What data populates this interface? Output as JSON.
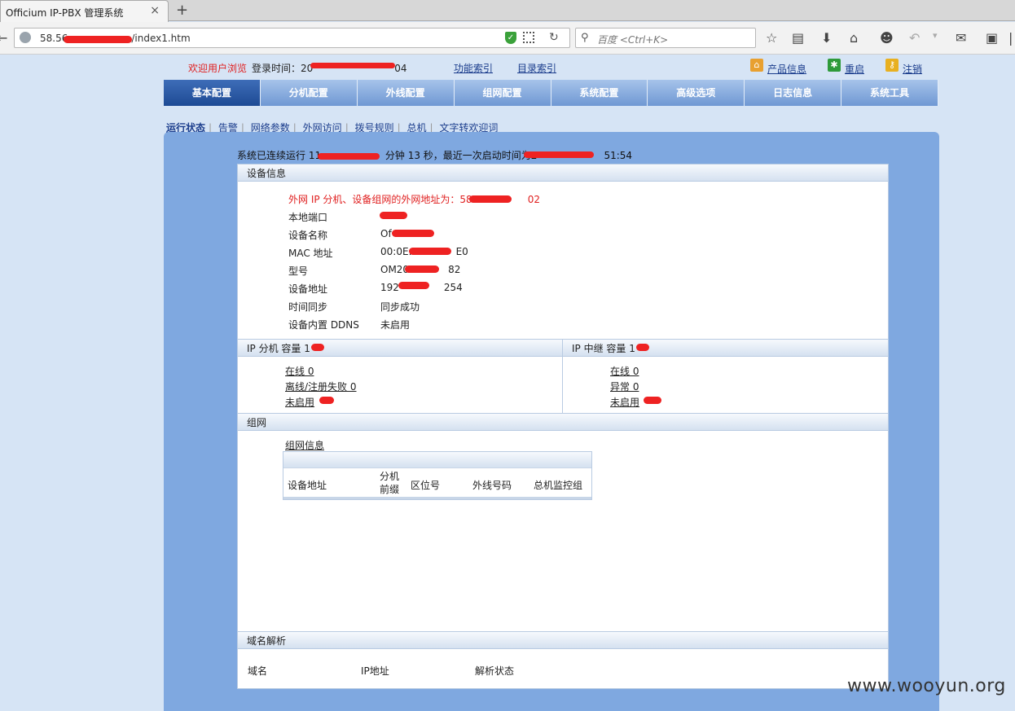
{
  "browser": {
    "tab_title": "Officium IP-PBX 管理系统",
    "tab_close": "×",
    "new_tab": "+",
    "url_start": "58.56",
    "url_end": "/index1.htm",
    "search_placeholder": "百度 <Ctrl+K>"
  },
  "header": {
    "welcome": "欢迎用户浏览",
    "login_time_label": "登录时间：20",
    "login_time_tail": "04",
    "function_index": "功能索引",
    "directory_index": "目录索引",
    "product_info": "产品信息",
    "restart": "重启",
    "logout": "注销"
  },
  "menu": {
    "items": [
      "基本配置",
      "分机配置",
      "外线配置",
      "组网配置",
      "系统配置",
      "高级选项",
      "日志信息",
      "系统工具"
    ],
    "active_index": 0
  },
  "submenu": {
    "items": [
      "运行状态",
      "告警",
      "网络参数",
      "外网访问",
      "拨号规则",
      "总机",
      "文字转欢迎词"
    ]
  },
  "status": {
    "uptime_prefix": "系统已连续运行 11 ",
    "uptime_mid": "分钟 13 秒，最近一次启动时间为2",
    "uptime_tail": "51:54"
  },
  "device_info": {
    "title": "设备信息",
    "public_ip_label": "外网 IP 分机、设备组网的外网地址为：58",
    "public_ip_tail": "02",
    "rows": [
      {
        "label": "本地端口",
        "value": ""
      },
      {
        "label": "设备名称",
        "value": "Of"
      },
      {
        "label": "MAC 地址",
        "value": "00:0E:",
        "tail": "E0"
      },
      {
        "label": "型号",
        "value": "OM20",
        "tail": "82"
      },
      {
        "label": "设备地址",
        "value": "192",
        "tail": "254"
      },
      {
        "label": "时间同步",
        "value": "同步成功"
      },
      {
        "label": "设备内置 DDNS",
        "value": "未启用"
      }
    ]
  },
  "ip_ext": {
    "title": "IP 分机 容量  1",
    "online": "在线 0",
    "offline": "离线/注册失败 0",
    "disabled": "未启用 "
  },
  "ip_trunk": {
    "title": "IP 中继 容量  1",
    "online": "在线 0",
    "abnormal": "异常 0",
    "disabled": "未启用 "
  },
  "network": {
    "title": "组网",
    "info_link": "组网信息",
    "columns": [
      "设备地址",
      "分机前缀",
      "区位号",
      "外线号码",
      "总机监控组"
    ]
  },
  "dns": {
    "title": "域名解析",
    "columns": [
      "域名",
      "IP地址",
      "解析状态"
    ]
  },
  "watermark": "www.wooyun.org",
  "colors": {
    "menu_active": "#1d4a94",
    "menu": "#6f98d3",
    "panel": "#7fa8e0",
    "alert_red": "#e02020",
    "redaction": "#ee2222"
  }
}
